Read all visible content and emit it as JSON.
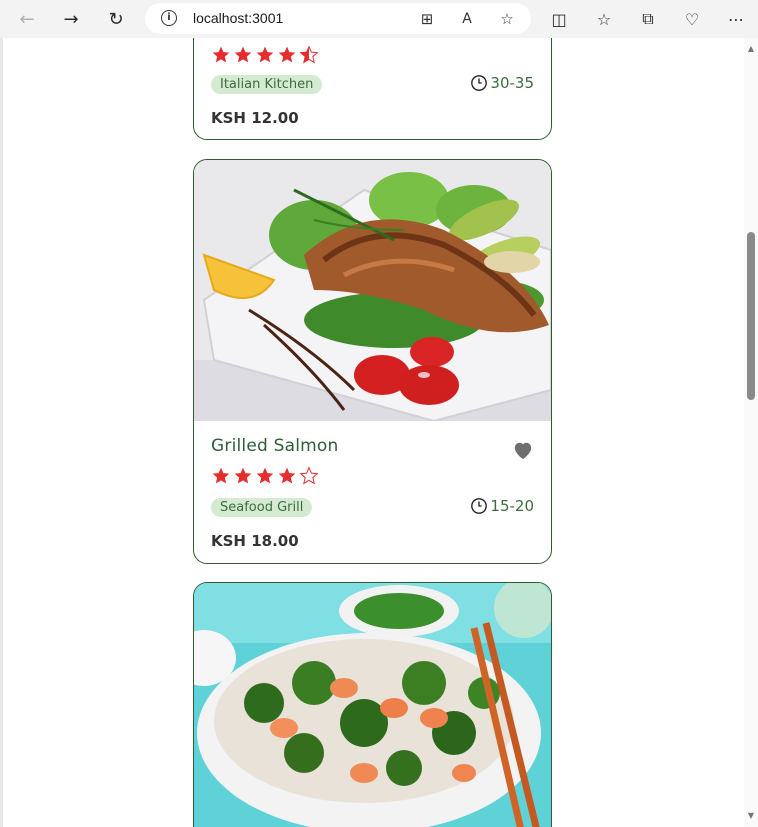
{
  "browser": {
    "url": "localhost:3001",
    "icons": [
      "back-icon",
      "forward-icon",
      "refresh-icon",
      "info-icon",
      "apps-icon",
      "read-aloud-icon",
      "favorite-icon",
      "split-screen-icon",
      "favorites-icon",
      "collections-icon",
      "browser-essentials-icon",
      "more-icon"
    ]
  },
  "colors": {
    "accent_green": "#2e5d36",
    "tag_bg": "#d4ebd2",
    "star_red": "#e52d2d",
    "heart_gray": "#6e6e6e"
  },
  "cards": [
    {
      "title": "",
      "rating": 4.5,
      "tag": "Italian Kitchen",
      "time": "30-35",
      "price": "KSH 12.00"
    },
    {
      "title": "Grilled Salmon",
      "rating": 4,
      "tag": "Seafood Grill",
      "time": "15-20",
      "price": "KSH 18.00",
      "image": "grilled salmon dish"
    },
    {
      "title": "",
      "image": "stir fry broccoli shrimp dish"
    }
  ]
}
